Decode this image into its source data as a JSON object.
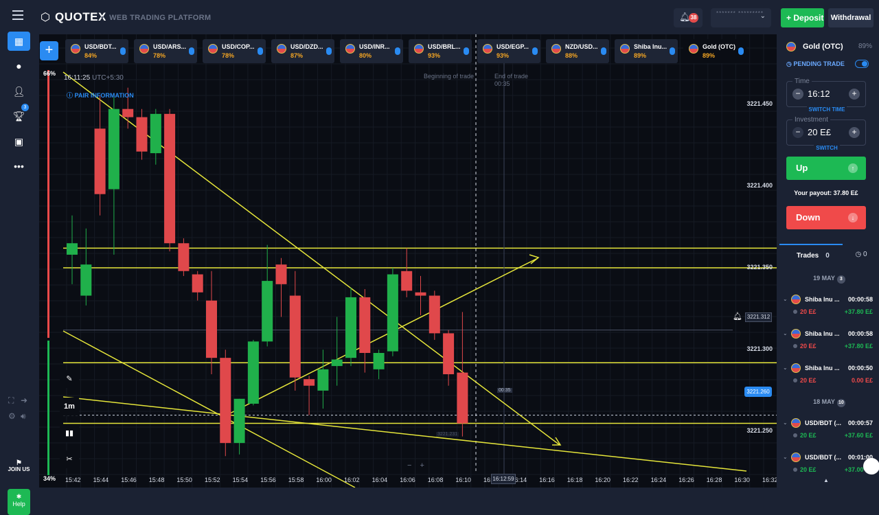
{
  "topbar": {
    "logo": "QUOTEX",
    "subtitle": "WEB TRADING PLATFORM",
    "notification_count": "38",
    "account_mask": "******* *********",
    "deposit": "Deposit",
    "withdrawal": "Withdrawal"
  },
  "sidebar": {
    "badge": "3",
    "join": "JOIN US",
    "help": "Help"
  },
  "assets": [
    {
      "name": "USD/BDT...",
      "pct": "84%"
    },
    {
      "name": "USD/ARS...",
      "pct": "78%"
    },
    {
      "name": "USD/COP...",
      "pct": "78%"
    },
    {
      "name": "USD/DZD...",
      "pct": "87%"
    },
    {
      "name": "USD/INR...",
      "pct": "80%"
    },
    {
      "name": "USD/BRL...",
      "pct": "93%"
    },
    {
      "name": "USD/EGP...",
      "pct": "93%"
    },
    {
      "name": "NZD/USD...",
      "pct": "88%"
    },
    {
      "name": "Shiba Inu...",
      "pct": "89%"
    },
    {
      "name": "Gold (OTC)",
      "pct": "89%"
    }
  ],
  "chart": {
    "clock_time": "16:11:25",
    "clock_tz": "UTC+5:30",
    "pair_info": "PAIR INFORMATION",
    "pct_top": "66%",
    "pct_bottom": "34%",
    "beginning_label": "Beginning of trade",
    "end_label": "End of trade",
    "end_countdown": "00:35",
    "countdown": "00:35",
    "timeframe": "1m",
    "price_hover": "3221.312",
    "price_current": "3221.260",
    "low_label": "3221.231",
    "time_current": "16:12:59",
    "price_ticks": [
      "3221.450",
      "3221.400",
      "3221.350",
      "3221.300",
      "3221.250"
    ],
    "time_ticks": [
      "15:42",
      "15:44",
      "15:46",
      "15:48",
      "15:50",
      "15:52",
      "15:54",
      "15:56",
      "15:58",
      "16:00",
      "16:02",
      "16:04",
      "16:06",
      "16:08",
      "16:10",
      "16:12",
      "16:14",
      "16:16",
      "16:18",
      "16:20",
      "16:22",
      "16:24",
      "16:26",
      "16:28",
      "16:30",
      "16:32"
    ]
  },
  "chart_data": {
    "type": "candlestick",
    "timeframe": "1m",
    "ylim": [
      3221.22,
      3221.48
    ],
    "candles": [
      {
        "t": "15:42",
        "o": 3221.358,
        "h": 3221.382,
        "l": 3221.34,
        "c": 3221.365
      },
      {
        "t": "15:43",
        "o": 3221.333,
        "h": 3221.374,
        "l": 3221.327,
        "c": 3221.352
      },
      {
        "t": "15:44",
        "o": 3221.435,
        "h": 3221.455,
        "l": 3221.382,
        "c": 3221.395
      },
      {
        "t": "15:45",
        "o": 3221.398,
        "h": 3221.455,
        "l": 3221.358,
        "c": 3221.447
      },
      {
        "t": "15:46",
        "o": 3221.447,
        "h": 3221.46,
        "l": 3221.435,
        "c": 3221.442
      },
      {
        "t": "15:47",
        "o": 3221.442,
        "h": 3221.447,
        "l": 3221.416,
        "c": 3221.421
      },
      {
        "t": "15:48",
        "o": 3221.42,
        "h": 3221.447,
        "l": 3221.413,
        "c": 3221.444
      },
      {
        "t": "15:49",
        "o": 3221.444,
        "h": 3221.447,
        "l": 3221.36,
        "c": 3221.365
      },
      {
        "t": "15:50",
        "o": 3221.365,
        "h": 3221.368,
        "l": 3221.345,
        "c": 3221.348
      },
      {
        "t": "15:51",
        "o": 3221.346,
        "h": 3221.348,
        "l": 3221.33,
        "c": 3221.335
      },
      {
        "t": "15:52",
        "o": 3221.33,
        "h": 3221.348,
        "l": 3221.285,
        "c": 3221.295
      },
      {
        "t": "15:53",
        "o": 3221.295,
        "h": 3221.3,
        "l": 3221.235,
        "c": 3221.243
      },
      {
        "t": "15:54",
        "o": 3221.243,
        "h": 3221.27,
        "l": 3221.236,
        "c": 3221.27
      },
      {
        "t": "15:55",
        "o": 3221.267,
        "h": 3221.306,
        "l": 3221.266,
        "c": 3221.305
      },
      {
        "t": "15:56",
        "o": 3221.305,
        "h": 3221.364,
        "l": 3221.302,
        "c": 3221.342
      },
      {
        "t": "15:57",
        "o": 3221.352,
        "h": 3221.356,
        "l": 3221.32,
        "c": 3221.34
      },
      {
        "t": "15:58",
        "o": 3221.333,
        "h": 3221.348,
        "l": 3221.275,
        "c": 3221.283
      },
      {
        "t": "15:59",
        "o": 3221.282,
        "h": 3221.284,
        "l": 3221.26,
        "c": 3221.278
      },
      {
        "t": "16:00",
        "o": 3221.275,
        "h": 3221.3,
        "l": 3221.264,
        "c": 3221.288
      },
      {
        "t": "16:01",
        "o": 3221.29,
        "h": 3221.32,
        "l": 3221.278,
        "c": 3221.294
      },
      {
        "t": "16:02",
        "o": 3221.295,
        "h": 3221.338,
        "l": 3221.29,
        "c": 3221.332
      },
      {
        "t": "16:03",
        "o": 3221.332,
        "h": 3221.337,
        "l": 3221.286,
        "c": 3221.298
      },
      {
        "t": "16:04",
        "o": 3221.288,
        "h": 3221.3,
        "l": 3221.282,
        "c": 3221.298
      },
      {
        "t": "16:05",
        "o": 3221.299,
        "h": 3221.35,
        "l": 3221.296,
        "c": 3221.346
      },
      {
        "t": "16:06",
        "o": 3221.348,
        "h": 3221.362,
        "l": 3221.332,
        "c": 3221.336
      },
      {
        "t": "16:07",
        "o": 3221.335,
        "h": 3221.345,
        "l": 3221.321,
        "c": 3221.333
      },
      {
        "t": "16:08",
        "o": 3221.333,
        "h": 3221.336,
        "l": 3221.306,
        "c": 3221.31
      },
      {
        "t": "16:09",
        "o": 3221.31,
        "h": 3221.312,
        "l": 3221.278,
        "c": 3221.285
      },
      {
        "t": "16:10",
        "o": 3221.286,
        "h": 3221.323,
        "l": 3221.247,
        "c": 3221.255
      }
    ]
  },
  "panel": {
    "asset_name": "Gold (OTC)",
    "asset_pct": "89%",
    "pending_trade": "PENDING TRADE",
    "time_label": "Time",
    "time_value": "16:12",
    "switch_time": "SWITCH TIME",
    "investment_label": "Investment",
    "investment_value": "20 E£",
    "switch": "SWITCH",
    "up": "Up",
    "payout_label": "Your payout:",
    "payout_value": "37.80 E£",
    "down": "Down",
    "trades_label": "Trades",
    "trades_count": "0",
    "timer_count": "0"
  },
  "history": [
    {
      "date": "19 MAY",
      "badge": "3",
      "trades": [
        {
          "asset": "Shiba Inu ...",
          "duration": "00:00:58",
          "amount": "20 E£",
          "payout": "+37.80 E£",
          "win": false
        },
        {
          "asset": "Shiba Inu ...",
          "duration": "00:00:58",
          "amount": "20 E£",
          "payout": "+37.80 E£",
          "win": false
        },
        {
          "asset": "Shiba Inu ...",
          "duration": "00:00:50",
          "amount": "20 E£",
          "payout": "0.00 E£",
          "win": false
        }
      ]
    },
    {
      "date": "18 MAY",
      "badge": "10",
      "trades": [
        {
          "asset": "USD/BDT (...",
          "duration": "00:00:57",
          "amount": "20 E£",
          "payout": "+37.60 E£",
          "win": true
        },
        {
          "asset": "USD/BDT (...",
          "duration": "00:01:00",
          "amount": "20 E£",
          "payout": "+37.00 E£",
          "win": true
        }
      ]
    }
  ],
  "colors": {
    "green": "#1db954",
    "red": "#f04a4a",
    "bull_candle": "#20b04b",
    "bear_candle": "#e0484b",
    "trendline": "#e6e63a",
    "accent": "#2a8bf2"
  }
}
